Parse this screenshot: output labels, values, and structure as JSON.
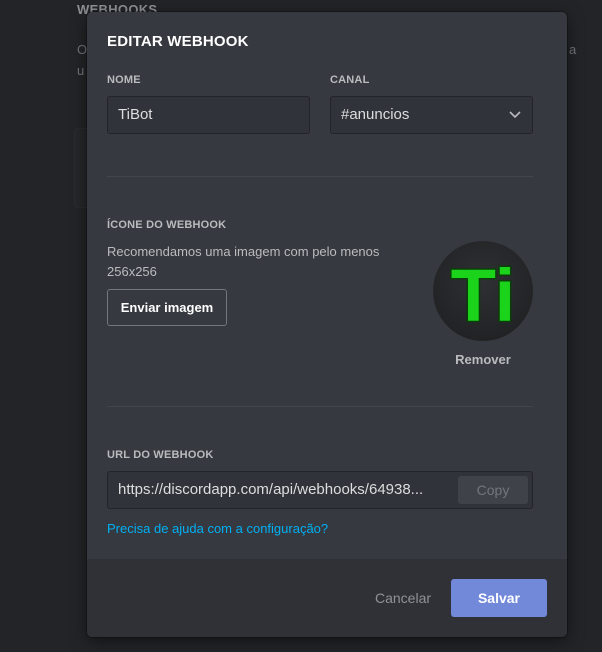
{
  "background": {
    "section_title": "WEBHOOKS",
    "text_line1": "O",
    "text_line2": "u",
    "text_right1": "a",
    "text_right2": ""
  },
  "modal": {
    "title": "EDITAR WEBHOOK",
    "name": {
      "label": "NOME",
      "value": "TiBot"
    },
    "channel": {
      "label": "CANAL",
      "value": "#anuncios"
    },
    "icon_section": {
      "label": "ÍCONE DO WEBHOOK",
      "description": "Recomendamos uma imagem com pelo menos 256x256",
      "upload_label": "Enviar imagem",
      "avatar_text": "Ti",
      "remove_label": "Remover"
    },
    "url_section": {
      "label": "URL DO WEBHOOK",
      "value": "https://discordapp.com/api/webhooks/64938...",
      "copy_label": "Copy"
    },
    "help_link": "Precisa de ajuda com a configuração?",
    "footer": {
      "cancel_label": "Cancelar",
      "save_label": "Salvar"
    }
  },
  "colors": {
    "modal_bg": "#36393f",
    "footer_bg": "#2f3136",
    "accent": "#7289da",
    "link": "#00b0f4",
    "avatar_letters": "#1cd31c"
  },
  "icons": {
    "select": "chevron-down-icon"
  }
}
